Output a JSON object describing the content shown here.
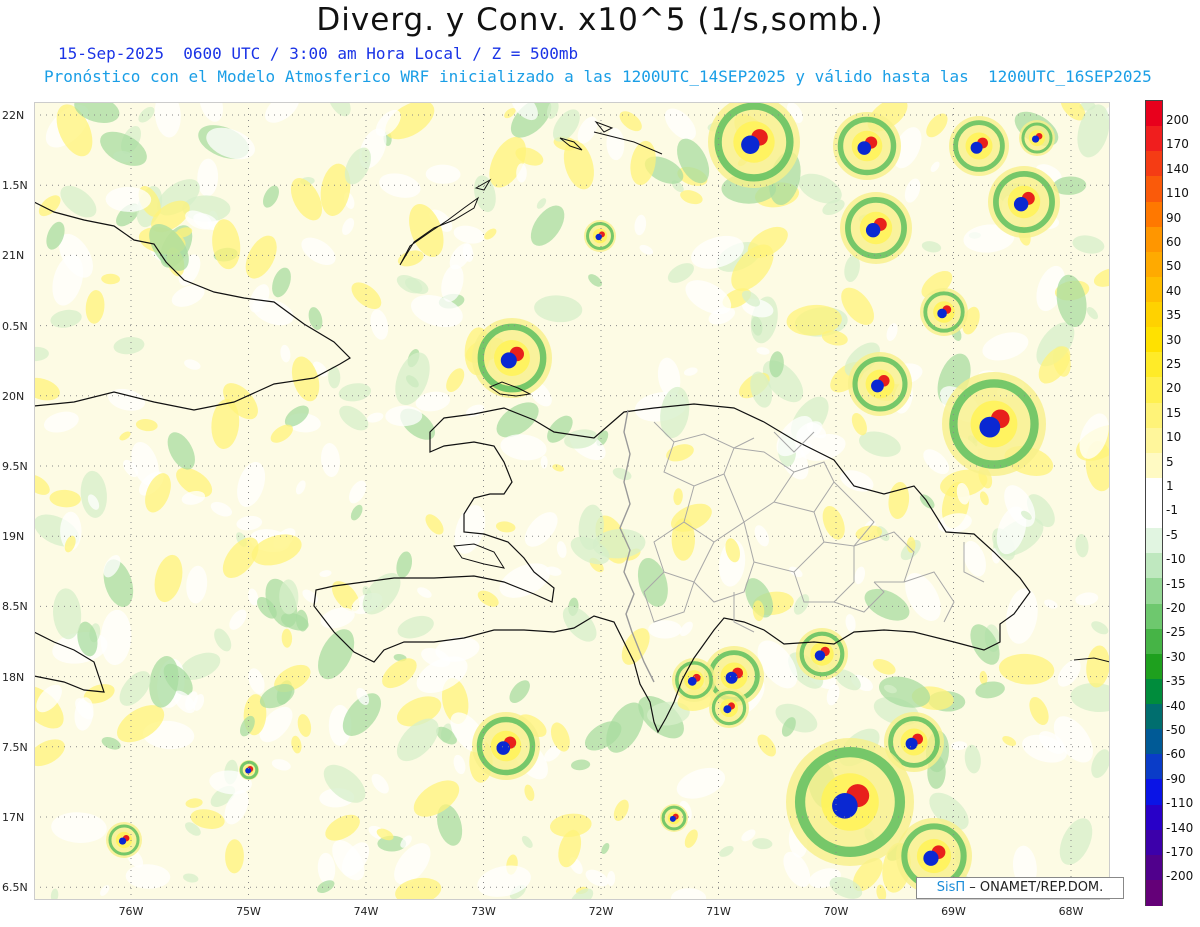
{
  "header": {
    "title": "Diverg. y Conv. x10^5 (1/s,somb.)",
    "subtitle1": "15-Sep-2025  0600 UTC / 3:00 am Hora Local / Z = 500mb",
    "subtitle2": "Pronóstico con el Modelo Atmosferico WRF inicializado a las 1200UTC_14SEP2025 y válido hasta las  1200UTC_16SEP2025"
  },
  "map": {
    "lat_labels": [
      "22N",
      "1.5N",
      "21N",
      "0.5N",
      "20N",
      "9.5N",
      "19N",
      "8.5N",
      "18N",
      "7.5N",
      "17N",
      "6.5N"
    ],
    "lon_labels": [
      "76W",
      "75W",
      "74W",
      "73W",
      "72W",
      "71W",
      "70W",
      "69W",
      "68W"
    ]
  },
  "colorbar": {
    "labels": [
      "200",
      "170",
      "140",
      "110",
      "90",
      "60",
      "50",
      "40",
      "35",
      "30",
      "25",
      "20",
      "15",
      "10",
      "5",
      "1",
      "-1",
      "-5",
      "-10",
      "-15",
      "-20",
      "-25",
      "-30",
      "-35",
      "-40",
      "-50",
      "-60",
      "-90",
      "-110",
      "-140",
      "-170",
      "-200"
    ],
    "colors": [
      "#e8001c",
      "#f01e1e",
      "#f53c14",
      "#fa5a0a",
      "#ff7800",
      "#ff9600",
      "#ffaa00",
      "#ffbe00",
      "#ffd200",
      "#ffe100",
      "#ffeb28",
      "#fff050",
      "#fff378",
      "#fff69b",
      "#fffac3",
      "#ffffff",
      "#ffffff",
      "#e1f5e1",
      "#bfe8bf",
      "#96d896",
      "#6ec86e",
      "#46b446",
      "#1ea01e",
      "#008c3c",
      "#006e6e",
      "#005a96",
      "#0a3cc8",
      "#0a14e6",
      "#2800c8",
      "#3c00aa",
      "#50008c",
      "#640078"
    ]
  },
  "credit": {
    "brand": "SisΠ",
    "org": "– ONAMET/REP.DOM."
  }
}
